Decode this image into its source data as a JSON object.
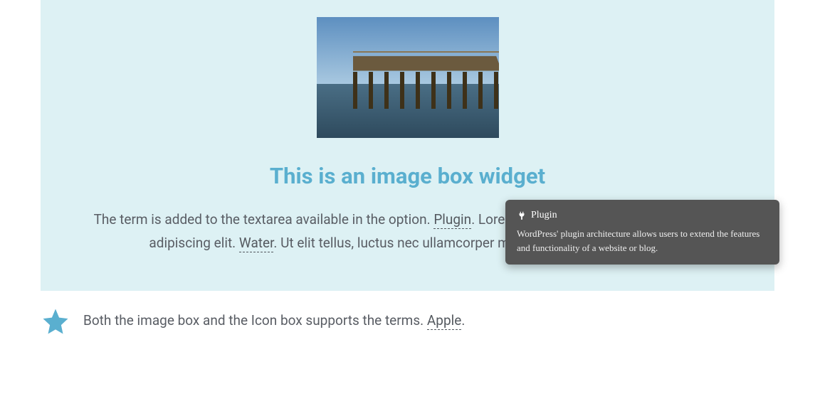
{
  "imageBox": {
    "heading": "This is an image box widget",
    "text_1": "The term is added to the textarea available in the option. ",
    "term_plugin": "Plugin",
    "text_2": ". Lorem ipsum dolor sit amet, consectetur adipiscing elit. ",
    "term_water": "Water",
    "text_3": ". Ut elit tellus, luctus nec ullamcorper mattis, pulvinar dapibus leo."
  },
  "iconRow": {
    "text_1": "Both the image box and the Icon box supports the terms. ",
    "term_apple": "Apple",
    "text_2": "."
  },
  "tooltip": {
    "title": "Plugin",
    "body": "WordPress' plugin architecture allows users to extend the features and functionality of a website or blog."
  }
}
